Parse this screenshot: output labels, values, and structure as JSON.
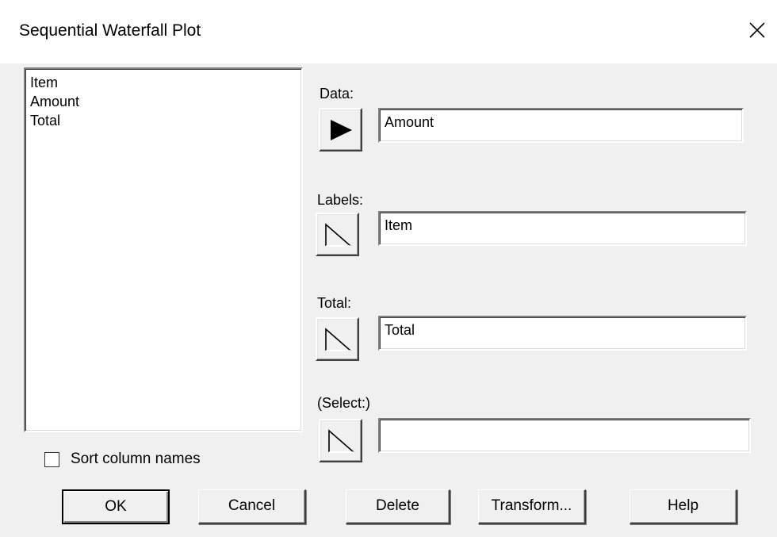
{
  "window": {
    "title": "Sequential Waterfall Plot",
    "close_icon": "close-icon"
  },
  "variable_list": {
    "items": [
      "Item",
      "Amount",
      "Total"
    ]
  },
  "sort_option": {
    "label": "Sort column names",
    "checked": false
  },
  "fields": {
    "data": {
      "label": "Data:",
      "value": "Amount",
      "arrow": "play-arrow-filled-icon"
    },
    "labels": {
      "label": "Labels:",
      "value": "Item",
      "arrow": "play-arrow-outline-icon"
    },
    "total": {
      "label": "Total:",
      "value": "Total",
      "arrow": "play-arrow-outline-icon"
    },
    "select": {
      "label": "(Select:)",
      "value": "",
      "arrow": "play-arrow-outline-icon"
    }
  },
  "buttons": {
    "ok": "OK",
    "cancel": "Cancel",
    "delete": "Delete",
    "transform": "Transform...",
    "help": "Help"
  }
}
